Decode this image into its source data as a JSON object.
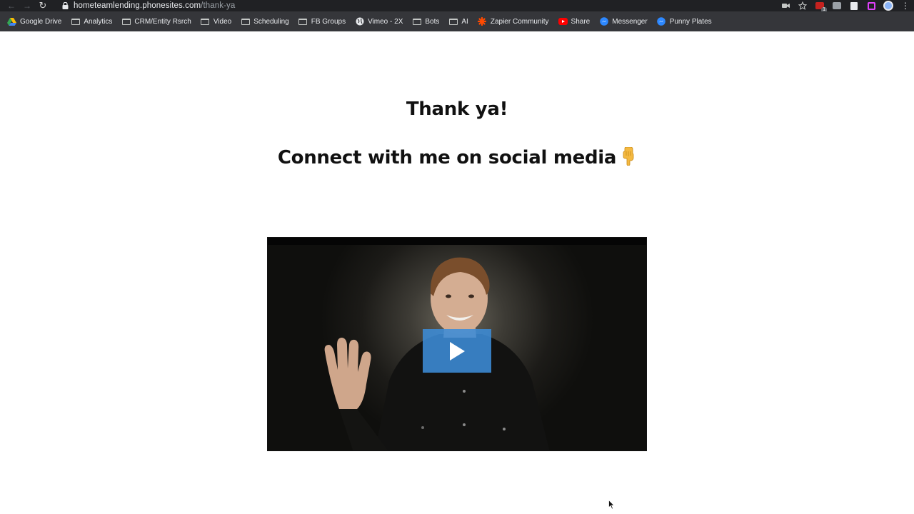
{
  "browser": {
    "url_host": "hometeamlending.phonesites.com",
    "url_path": "/thank-ya",
    "extension_badge": "1",
    "bookmarks": [
      {
        "label": "Google Drive",
        "icon": "google-drive-icon"
      },
      {
        "label": "Analytics",
        "icon": "folder-icon"
      },
      {
        "label": "CRM/Entity Rsrch",
        "icon": "folder-icon"
      },
      {
        "label": "Video",
        "icon": "folder-icon"
      },
      {
        "label": "Scheduling",
        "icon": "folder-icon"
      },
      {
        "label": "FB Groups",
        "icon": "folder-icon"
      },
      {
        "label": "Vimeo - 2X",
        "icon": "globe-icon"
      },
      {
        "label": "Bots",
        "icon": "folder-icon"
      },
      {
        "label": "AI",
        "icon": "folder-icon"
      },
      {
        "label": "Zapier Community",
        "icon": "zapier-icon"
      },
      {
        "label": "Share",
        "icon": "youtube-icon"
      },
      {
        "label": "Messenger",
        "icon": "messenger-icon"
      },
      {
        "label": "Punny Plates",
        "icon": "messenger-icon"
      }
    ]
  },
  "page": {
    "heading": "Thank ya!",
    "subheading": "Connect with me on social media",
    "subheading_emoji": "pointing-down-hand-icon",
    "video": {
      "thumbnail": "man-waving-video-thumbnail",
      "play_icon": "play-icon",
      "accent": "#3c8cd7"
    }
  }
}
